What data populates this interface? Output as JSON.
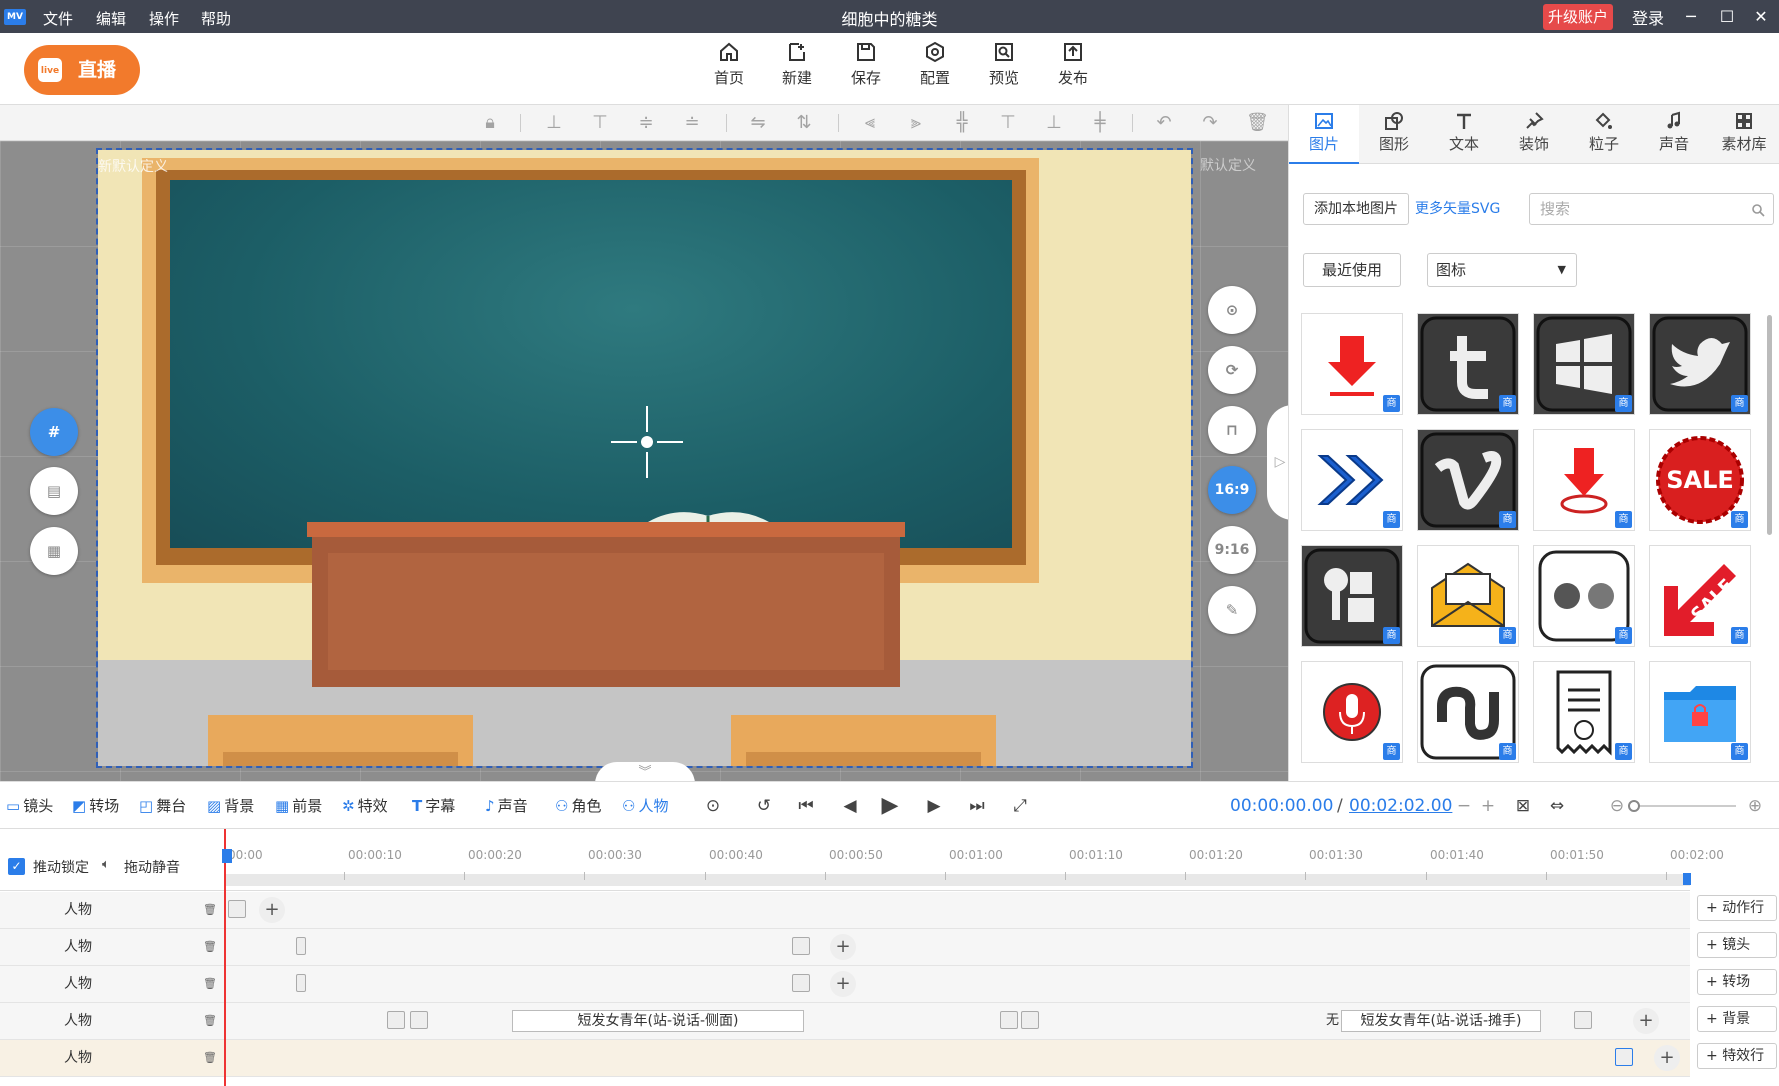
{
  "window": {
    "app_logo": "MV",
    "title": "细胞中的糖类",
    "menus": [
      "文件",
      "编辑",
      "操作",
      "帮助"
    ],
    "upgrade": "升级账户",
    "login": "登录",
    "minimize": "─",
    "maximize": "☐",
    "close": "✕"
  },
  "toolbar": {
    "live": "直播",
    "live_icon": "live",
    "items": [
      {
        "label": "首页",
        "icon": "home-icon"
      },
      {
        "label": "新建",
        "icon": "new-icon"
      },
      {
        "label": "保存",
        "icon": "save-icon"
      },
      {
        "label": "配置",
        "icon": "settings-icon"
      },
      {
        "label": "预览",
        "icon": "preview-icon"
      },
      {
        "label": "发布",
        "icon": "publish-icon"
      }
    ]
  },
  "stage": {
    "canvas_label": "新默认定义",
    "canvas_label_right": "默认定义",
    "side_left": [
      "grid-icon",
      "layers-icon",
      "calendar-icon"
    ],
    "side_right": [
      "camera-icon",
      "rotate-icon",
      "lock-icon",
      "16:9",
      "9:16",
      "edit-icon"
    ]
  },
  "panel": {
    "tabs": [
      "图片",
      "图形",
      "文本",
      "装饰",
      "粒子",
      "声音",
      "素材库"
    ],
    "add_local": "添加本地图片",
    "more_svg": "更多矢量SVG",
    "search_placeholder": "搜索",
    "recent": "最近使用",
    "category": "图标",
    "badge": "商",
    "assets": [
      "download-arrow-icon",
      "tumblr-sketch-icon",
      "windows-sketch-icon",
      "twitter-sketch-icon",
      "fast-forward-icon",
      "vimeo-sketch-icon",
      "download-pin-icon",
      "sale-badge-icon",
      "robot-sketch-icon",
      "email-icon",
      "flickr-icon",
      "sale-arrow-icon",
      "microphone-icon",
      "stumbleupon-sketch-icon",
      "receipt-icon",
      "folder-lock-icon"
    ]
  },
  "timeline_tabs": [
    {
      "label": "镜头",
      "icon": "▭"
    },
    {
      "label": "转场",
      "icon": "◩"
    },
    {
      "label": "舞台",
      "icon": "◰"
    },
    {
      "label": "背景",
      "icon": "▨"
    },
    {
      "label": "前景",
      "icon": "▦"
    },
    {
      "label": "特效",
      "icon": "✲"
    },
    {
      "label": "字幕",
      "icon": "T"
    },
    {
      "label": "声音",
      "icon": "♪"
    },
    {
      "label": "角色",
      "icon": "⚇"
    },
    {
      "label": "人物",
      "icon": "⚇"
    }
  ],
  "playback": {
    "current_time": "00:00:00.00",
    "separator": "/",
    "total_time": "00:02:02.00"
  },
  "timeline": {
    "lock_label": "推动锁定",
    "mute_label": "拖动静音",
    "ticks": [
      "00:00",
      "00:00:10",
      "00:00:20",
      "00:00:30",
      "00:00:40",
      "00:00:50",
      "00:01:00",
      "00:01:10",
      "00:01:20",
      "00:01:30",
      "00:01:40",
      "00:01:50",
      "00:02:00"
    ],
    "tracks": [
      {
        "label": "人物"
      },
      {
        "label": "人物"
      },
      {
        "label": "人物"
      },
      {
        "label": "人物",
        "clip1": "短发女青年(站-说话-侧面)",
        "clip2": "短发女青年(站-说话-摊手)",
        "mark": "无"
      },
      {
        "label": "人物"
      }
    ],
    "right_buttons": [
      "动作行",
      "镜头",
      "转场",
      "背景",
      "特效行"
    ]
  }
}
